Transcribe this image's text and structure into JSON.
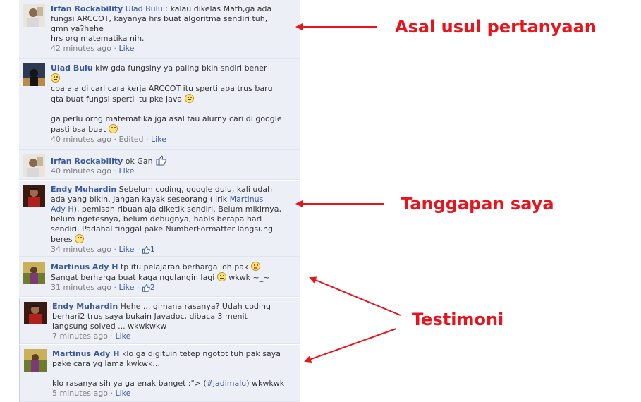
{
  "comments": [
    {
      "author": "Irfan Rockability",
      "mention": "Ulad Bulu",
      "line1_rest": ":: kalau dikelas Math,ga ada",
      "line2": "fungsi ARCCOT, kayanya hrs buat algoritma sendiri tuh,",
      "line3": "gmn ya?hehe",
      "line4": "hrs org matematika nih.",
      "time": "42 minutes ago",
      "like": "Like"
    },
    {
      "author": "Ulad Bulu",
      "line1_rest": "klw gda fungsiny ya paling bkin sndiri bener",
      "line3": "cba aja di cari cara kerja ARCCOT itu sperti apa trus baru",
      "line4": "qta buat fungsi sperti itu pke java",
      "line5": "ga perlu orng matematika jga asal tau alurny cari di google",
      "line6": "pasti bsa buat",
      "time": "40 minutes ago",
      "edited": "Edited",
      "like": "Like"
    },
    {
      "author": "Irfan Rockability",
      "line1_rest": "ok Gan",
      "time": "40 minutes ago",
      "like": "Like"
    },
    {
      "author": "Endy Muhardin",
      "line1_rest": "Sebelum coding, google dulu, kali udah",
      "line2": "ada yang bikin. Jangan kayak seseorang (lirik",
      "mention": "Martinus",
      "mention2": "Ady H",
      "line3_rest": "), pemisah ribuan aja diketik sendiri. Belum mikirnya,",
      "line4": "belum ngetesnya, belum debugnya, habis berapa hari",
      "line5": "sendiri. Padahal tinggal pake NumberFormatter langsung",
      "line6": "beres",
      "time": "34 minutes ago",
      "like": "Like",
      "likes_count": "1"
    },
    {
      "author": "Martinus Ady H",
      "line1_rest": "tp itu pelajaran berharga loh pak",
      "line2": "Sangat berharga buat kaga ngulangin lagi",
      "line2_end": "wkwk ~_~",
      "time": "31 minutes ago",
      "like": "Like",
      "likes_count": "2"
    },
    {
      "author": "Endy Muhardin",
      "line1_rest": "Hehe ... gimana rasanya? Udah coding",
      "line2": "berhari2 trus saya bukain Javadoc, dibaca 3 menit",
      "line3": "langsung solved ... wkwkwkw",
      "time": "7 minutes ago",
      "like": "Like"
    },
    {
      "author": "Martinus Ady H",
      "line1_rest": "klo ga digituin tetep ngotot tuh pak saya",
      "line2": "pake cara yg lama kwkwk...",
      "line4_pre": "klo rasanya sih ya ga enak banget :\"> (",
      "hashtag": "#jadimalu",
      "line4_post": ") wkwkwk",
      "time": "5 minutes ago",
      "like": "Like"
    }
  ],
  "annotations": {
    "origin": "Asal usul pertanyaan",
    "response": "Tanggapan saya",
    "testimony": "Testimoni"
  },
  "colors": {
    "annotation": "#e8141c",
    "link": "#3b5998",
    "comment_bg": "#eceff5"
  }
}
